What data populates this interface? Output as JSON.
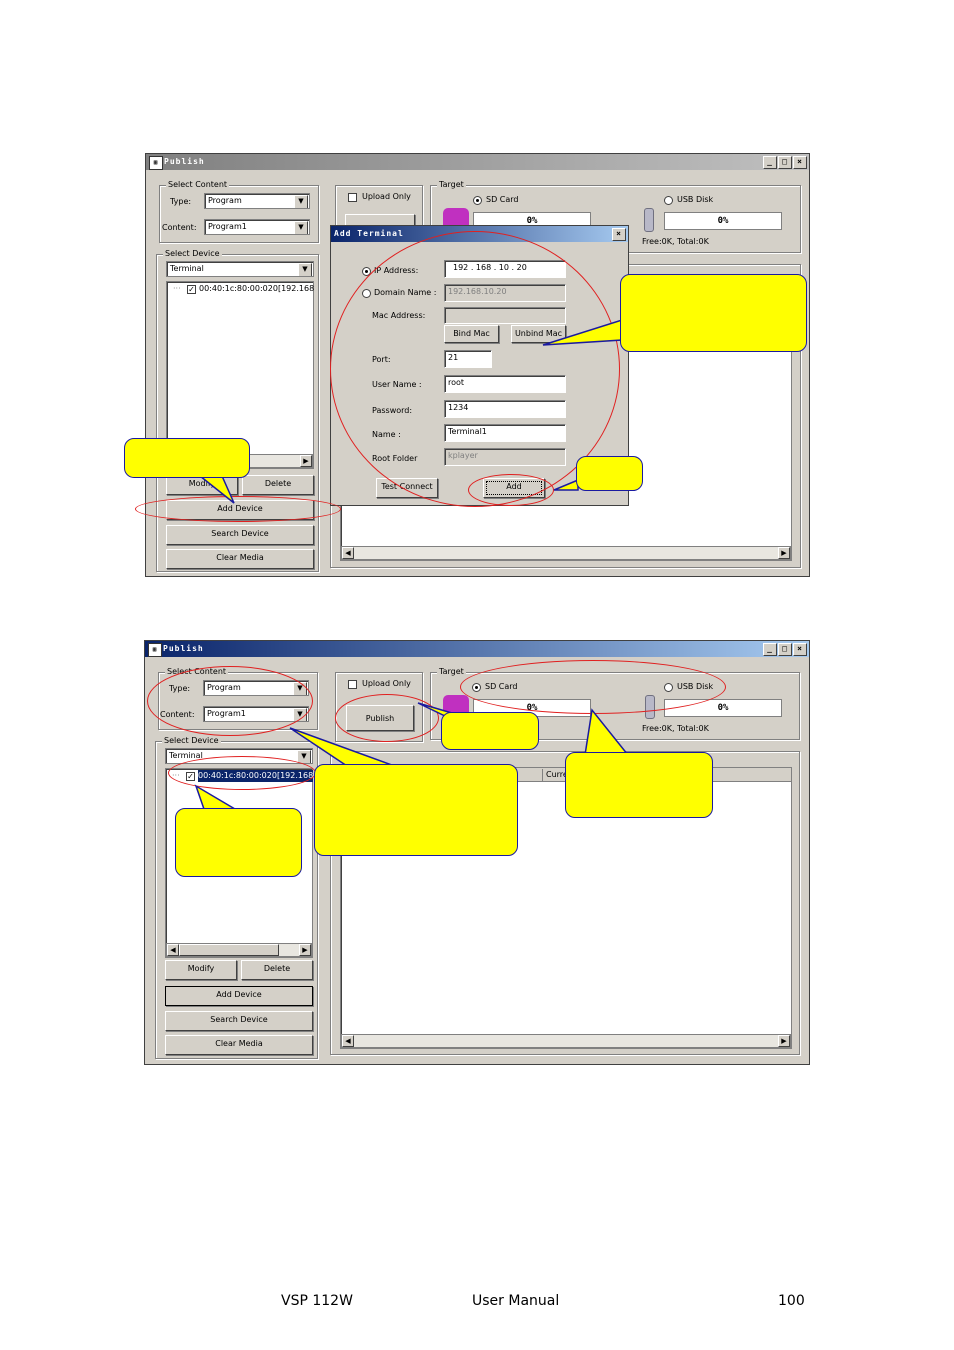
{
  "win1": {
    "title": "Publish",
    "select_content_label": "Select Content",
    "type_label": "Type:",
    "type_value": "Program",
    "content_label": "Content:",
    "content_value": "Program1",
    "upload_only": "Upload Only",
    "target_label": "Target",
    "sd_card": "SD Card",
    "usb_disk": "USB Disk",
    "sd_percent": "0%",
    "usb_percent": "0%",
    "free_total": "Free:0K, Total:0K",
    "select_device_label": "Select Device",
    "device_type": "Terminal",
    "device_item": "00:40:1c:80:00:020[192.168",
    "modify": "Modify",
    "delete": "Delete",
    "add_device": "Add Device",
    "search_device": "Search Device",
    "clear_media": "Clear Media"
  },
  "dialog": {
    "title": "Add Terminal",
    "ip_label": "IP Address:",
    "ip_value": "192 . 168 . 10 . 20",
    "domain_label": "Domain Name :",
    "domain_value": "192.168.10.20",
    "mac_label": "Mac Address:",
    "bind_mac": "Bind Mac",
    "unbind_mac": "Unbind Mac",
    "port_label": "Port:",
    "port_value": "21",
    "user_label": "User Name :",
    "user_value": "root",
    "password_label": "Password:",
    "password_value": "1234",
    "name_label": "Name :",
    "name_value": "Terminal1",
    "root_label": "Root Folder",
    "root_value": "kplayer",
    "test_connect": "Test Connect",
    "add": "Add"
  },
  "win2": {
    "title": "Publish",
    "select_content_label": "Select Content",
    "type_label": "Type:",
    "type_value": "Program",
    "content_label": "Content:",
    "content_value": "Program1",
    "upload_only": "Upload Only",
    "publish": "Publish",
    "target_label": "Target",
    "sd_card": "SD Card",
    "usb_disk": "USB Disk",
    "sd_percent": "0%",
    "usb_percent": "0%",
    "free_total": "Free:0K, Total:0K",
    "select_device_label": "Select Device",
    "device_type": "Terminal",
    "device_item": "00:40:1c:80:00:020[192.168",
    "col_current": "Curre",
    "modify": "Modify",
    "delete": "Delete",
    "add_device": "Add Device",
    "search_device": "Search Device",
    "clear_media": "Clear Media"
  },
  "footer": {
    "product": "VSP 112W",
    "manual": "User Manual",
    "page": "100"
  },
  "colors": {
    "callout": "#ffff00",
    "ring": "#e02020",
    "window": "#d4d0c8",
    "title_active": "#0a246a"
  }
}
